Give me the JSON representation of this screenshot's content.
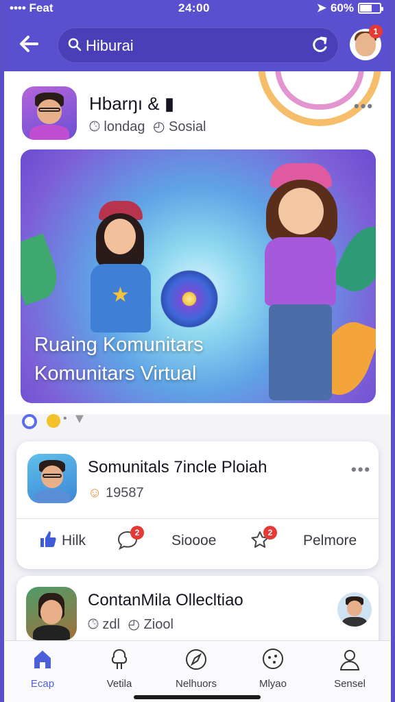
{
  "status_bar": {
    "carrier": "•••• Feat",
    "time": "24:00",
    "battery_text": "60%",
    "battery_level": 0.6
  },
  "header": {
    "search_value": "Hiburai",
    "notification_count": "1"
  },
  "post": {
    "author": "Hbarŋı",
    "author_suffix": "& ▮",
    "meta_time": "londag",
    "meta_category": "Sosial",
    "hero_line1": "Ruaing Komunitars",
    "hero_line2": "Komunitars Virtual"
  },
  "card1": {
    "title": "Somunitals 7incle Ploiah",
    "reactions": "19587",
    "actions": [
      {
        "label": "Hilk",
        "icon": "like-icon"
      },
      {
        "label": "",
        "icon": "comment-icon",
        "badge": "2"
      },
      {
        "label": "Sioooe",
        "icon": ""
      },
      {
        "label": "",
        "icon": "star-icon",
        "badge": "2"
      },
      {
        "label": "Pelmore",
        "icon": ""
      }
    ]
  },
  "card2": {
    "title": "ContanMila Ollecltiao",
    "meta_time": "zdl",
    "meta_category": "Ziool"
  },
  "bottom_nav": [
    {
      "label": "Ecap",
      "icon": "home-icon",
      "active": true
    },
    {
      "label": "Vetila",
      "icon": "tree-icon",
      "active": false
    },
    {
      "label": "Nelhuors",
      "icon": "compass-icon",
      "active": false
    },
    {
      "label": "Mlyao",
      "icon": "chat-icon",
      "active": false
    },
    {
      "label": "Sensel",
      "icon": "profile-icon",
      "active": false
    }
  ],
  "colors": {
    "primary": "#5a4fcf",
    "accent": "#4b5fd8",
    "badge": "#e53935"
  }
}
